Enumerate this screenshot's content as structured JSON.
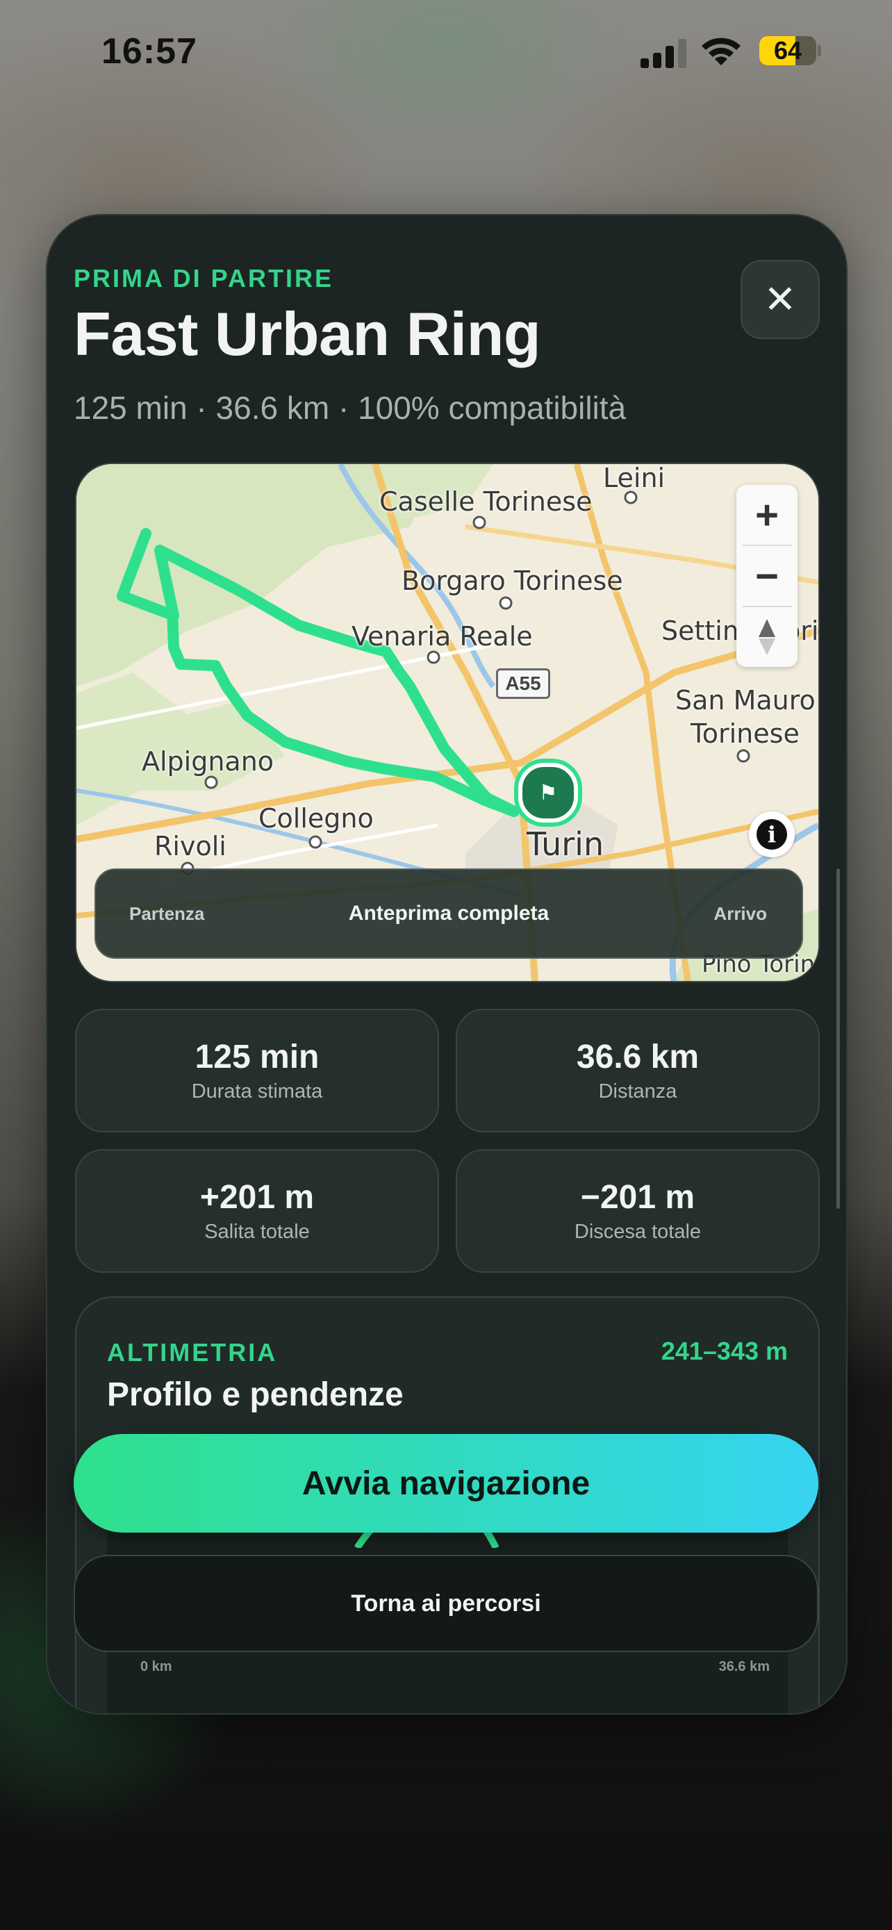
{
  "status_bar": {
    "time": "16:57",
    "battery": "64",
    "battery_level": 0.64
  },
  "sheet": {
    "eyebrow": "PRIMA DI PARTIRE",
    "title": "Fast Urban Ring",
    "subtitle": "125 min · 36.6 km · 100% compatibilità",
    "close_icon": "close-icon"
  },
  "map": {
    "labels": {
      "leini": "Leini",
      "caselle": "Caselle Torinese",
      "borgaro": "Borgaro Torinese",
      "venaria": "Venaria Reale",
      "settimo": "Settimo Torinese",
      "san_mauro": "San Mauro",
      "torinese": "Torinese",
      "alpignano": "Alpignano",
      "collegno": "Collegno",
      "rivoli": "Rivoli",
      "turin": "Turin",
      "pino": "Pino Torinese"
    },
    "road_shield": "A55",
    "zoom_in": "+",
    "zoom_out": "−",
    "route_color": "#2ee08e",
    "scrubber": {
      "start": "Partenza",
      "center": "Anteprima completa",
      "end": "Arrivo"
    }
  },
  "stats": [
    {
      "value": "125 min",
      "label": "Durata stimata"
    },
    {
      "value": "36.6 km",
      "label": "Distanza"
    },
    {
      "value": "+201 m",
      "label": "Salita totale"
    },
    {
      "value": "−201 m",
      "label": "Discesa totale"
    }
  ],
  "altimetry": {
    "eyebrow": "ALTIMETRIA",
    "range": "241–343 m",
    "title": "Profilo e pendenze",
    "x_start": "0 km",
    "x_end": "36.6 km"
  },
  "actions": {
    "primary": "Avvia navigazione",
    "secondary": "Torna ai percorsi"
  },
  "colors": {
    "accent": "#34d58a",
    "sheet": "#1c2523"
  }
}
